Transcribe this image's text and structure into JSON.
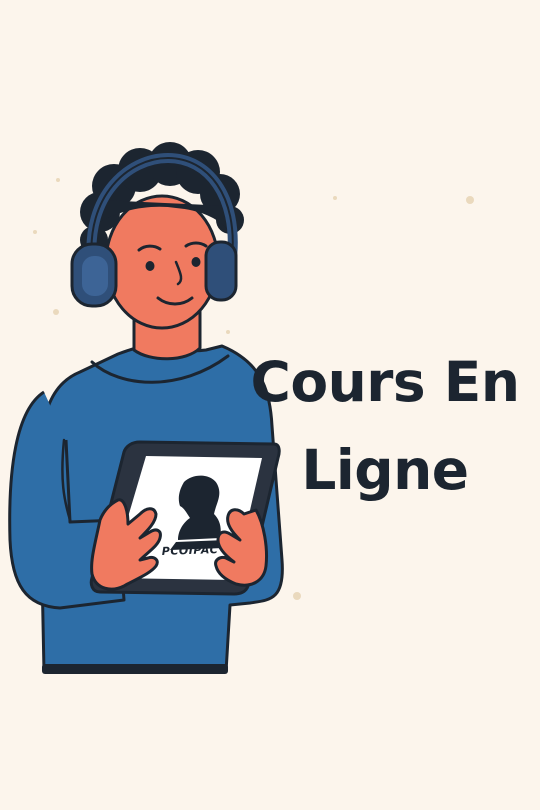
{
  "headline": {
    "line1": "Cours En",
    "line2": "Ligne"
  },
  "tablet": {
    "logo_text": "PCOIPAC"
  },
  "colors": {
    "background": "#fcf5ec",
    "sweater": "#2e6ea7",
    "skin": "#f07a60",
    "hair": "#1c2530",
    "headphones": "#2f4f79",
    "text": "#1c2530"
  },
  "icons": {
    "person": "person-with-headphones-illustration",
    "tablet": "tablet-icon",
    "logo": "portrait-logo-icon"
  }
}
